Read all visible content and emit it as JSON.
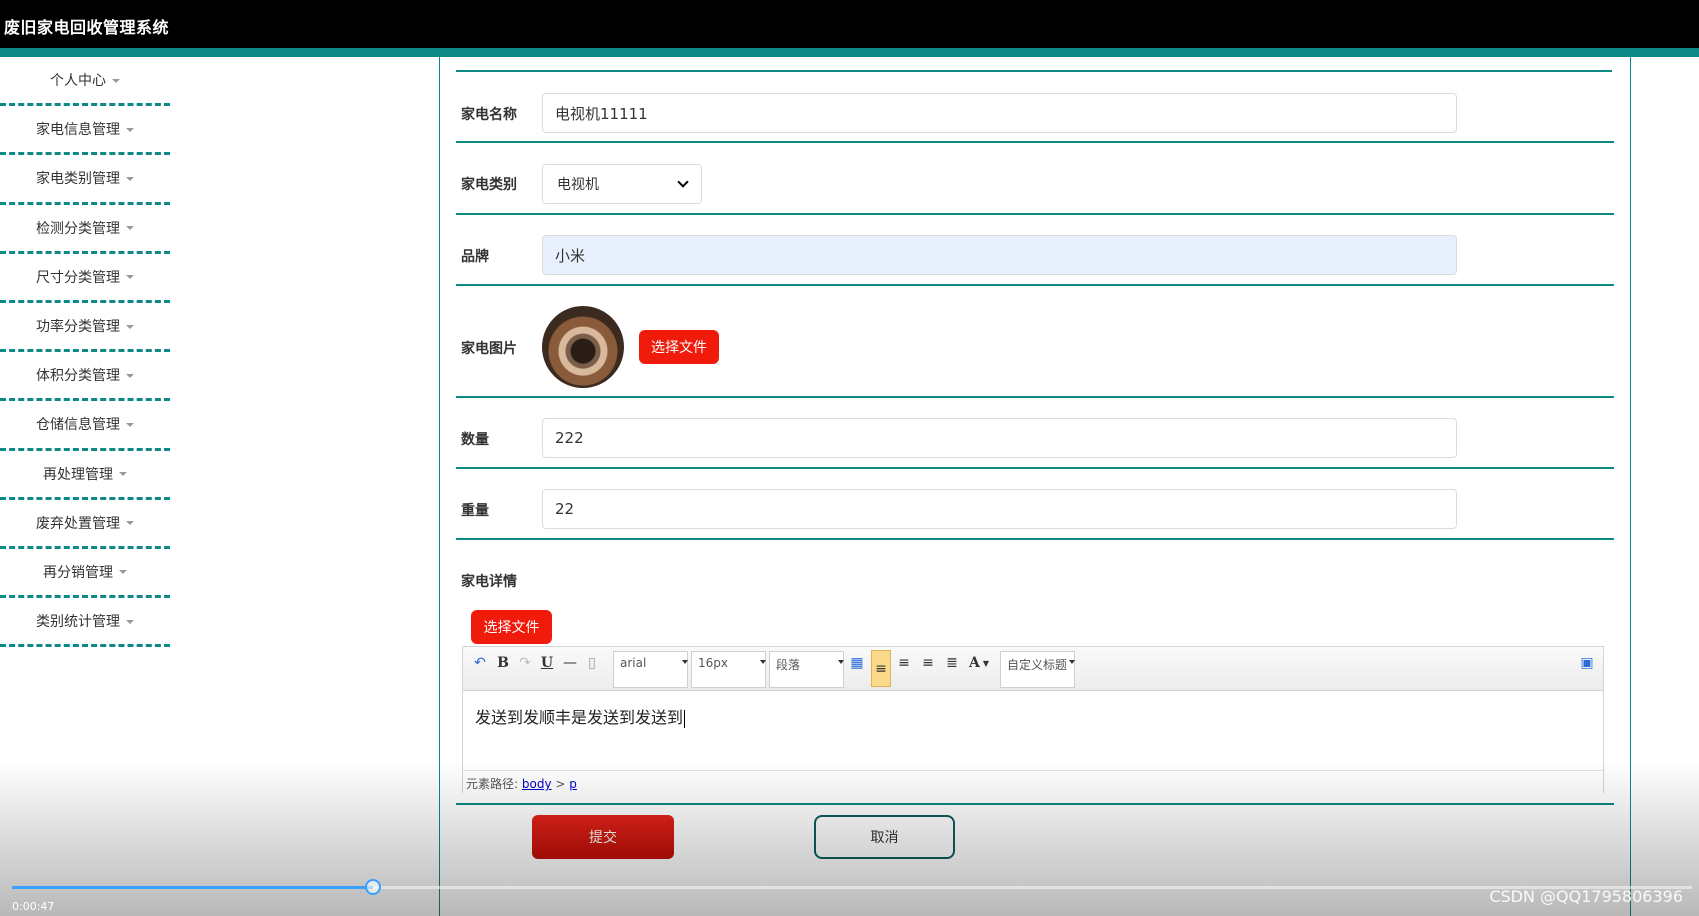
{
  "app": {
    "title": "废旧家电回收管理系统"
  },
  "sidebar": {
    "items": [
      {
        "label": "个人中心"
      },
      {
        "label": "家电信息管理"
      },
      {
        "label": "家电类别管理"
      },
      {
        "label": "检测分类管理"
      },
      {
        "label": "尺寸分类管理"
      },
      {
        "label": "功率分类管理"
      },
      {
        "label": "体积分类管理"
      },
      {
        "label": "仓储信息管理"
      },
      {
        "label": "再处理管理"
      },
      {
        "label": "废弃处置管理"
      },
      {
        "label": "再分销管理"
      },
      {
        "label": "类别统计管理"
      }
    ]
  },
  "form": {
    "name": {
      "label": "家电名称",
      "value": "电视机11111"
    },
    "category": {
      "label": "家电类别",
      "selected": "电视机"
    },
    "brand": {
      "label": "品牌",
      "value": "小米"
    },
    "image": {
      "label": "家电图片",
      "upload_label": "选择文件"
    },
    "quantity": {
      "label": "数量",
      "value": "222"
    },
    "weight": {
      "label": "重量",
      "value": "22"
    },
    "detail": {
      "label": "家电详情",
      "upload_label": "选择文件",
      "toolbar": {
        "font_family": "arial",
        "font_size": "16px",
        "paragraph": "段落",
        "custom_title": "自定义标题",
        "bold": "B",
        "underline": "U",
        "font_color": "A"
      },
      "content": "发送到发顺丰是发送到发送到",
      "path_label": "元素路径:",
      "path_body": "body",
      "path_sep": ">",
      "path_p": "p"
    },
    "submit_label": "提交",
    "cancel_label": "取消"
  },
  "player": {
    "time": "0:00:47",
    "progress": 0.215
  },
  "watermark": "CSDN @QQ1795806396",
  "colors": {
    "teal": "#0d8a86",
    "accent_red": "#f11b0b"
  }
}
